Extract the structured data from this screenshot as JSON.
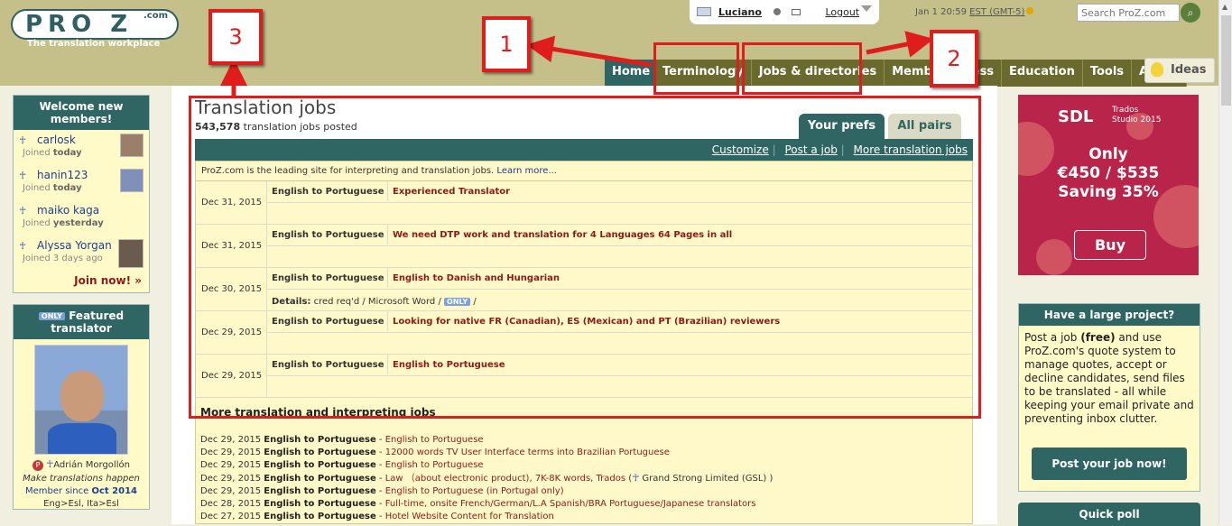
{
  "header": {
    "logo_text": "PRO Z",
    "logo_com": ".com",
    "tagline": "The translation workplace",
    "user": "Luciano",
    "logout": "Logout",
    "clock": "Jan 1 20:59",
    "timezone": "EST (GMT-5)",
    "search_placeholder": "Search ProZ.com"
  },
  "nav": [
    "Home",
    "Terminology",
    "Jobs & directories",
    "Member access",
    "Education",
    "Tools",
    "About"
  ],
  "ideas": "Ideas",
  "welcome": {
    "title": "Welcome new members!",
    "members": [
      {
        "name": "carlosk",
        "joined": "Joined",
        "when": "today"
      },
      {
        "name": "hanin123",
        "joined": "Joined",
        "when": "today"
      },
      {
        "name": "maiko kaga",
        "joined": "Joined",
        "when": "yesterday"
      },
      {
        "name": "Alyssa Yorgan",
        "joined": "Joined 3 days ago",
        "when": ""
      }
    ],
    "join_now": "Join now! »"
  },
  "featured": {
    "only_badge": "ONLY",
    "title": "Featured translator",
    "p_badge": "P",
    "name": "Adrián Morgollón",
    "tagline": "Make translations happen",
    "since_prefix": "Member since",
    "since": "Oct 2014",
    "pairs": "Eng>Esl, Ita>Esl"
  },
  "jobs": {
    "title": "Translation jobs",
    "count": "543,578",
    "count_label": "translation jobs posted",
    "tab_prefs": "Your prefs",
    "tab_all": "All pairs",
    "bar_links": [
      "Customize",
      "Post a job",
      "More translation jobs"
    ],
    "bar_sep": "|",
    "lead_text": "ProZ.com is the leading site for interpreting and translation jobs.",
    "lead_link": "Learn more...",
    "rows": [
      {
        "date": "Dec 31, 2015",
        "pair": "English to Portuguese",
        "title": "Experienced Translator",
        "details": ""
      },
      {
        "date": "Dec 31, 2015",
        "pair": "English to Portuguese",
        "title": "We need DTP work and translation for 4 Languages 64 Pages in all",
        "details": ""
      },
      {
        "date": "Dec 30, 2015",
        "pair": "English to Portuguese",
        "title": "English to Danish and Hungarian",
        "details_label": "Details:",
        "details": "cred req'd / Microsoft Word /",
        "details_badge": "ONLY",
        "details_end": "/"
      },
      {
        "date": "Dec 29, 2015",
        "pair": "English to Portuguese",
        "title": "Looking for native FR (Canadian), ES (Mexican) and PT (Brazilian) reviewers",
        "details": ""
      },
      {
        "date": "Dec 29, 2015",
        "pair": "English to Portuguese",
        "title": "English to Portuguese",
        "details": ""
      }
    ],
    "more_title": "More translation and interpreting jobs",
    "more": [
      {
        "date": "Dec 29, 2015",
        "pair": "English to Portuguese",
        "sep": " - ",
        "title": "English to Portuguese"
      },
      {
        "date": "Dec 29, 2015",
        "pair": "English to Portuguese",
        "sep": " - ",
        "title": "12000 words TV User Interface terms into Brazilian Portuguese"
      },
      {
        "date": "Dec 29, 2015",
        "pair": "English to Portuguese",
        "sep": " - ",
        "title": "English to Portuguese"
      },
      {
        "date": "Dec 29, 2015",
        "pair": "English to Portuguese",
        "sep": " - ",
        "title": "Law （about electronic product), 7K-8K words, Trados (",
        "suffix": " Grand Strong Limited (GSL) )"
      },
      {
        "date": "Dec 29, 2015",
        "pair": "English to Portuguese",
        "sep": " - ",
        "title": "English to Portuguese (in Portugal only)"
      },
      {
        "date": "Dec 28, 2015",
        "pair": "English to Portuguese",
        "sep": " - ",
        "title": "Full-time, onsite French/German/L.A Spanish/BRA Portuguese/Japanese translators"
      },
      {
        "date": "Dec 27, 2015",
        "pair": "English to Portuguese",
        "sep": " - ",
        "title": "Hotel Website Content for Translation"
      }
    ]
  },
  "ad": {
    "brand": "SDL",
    "product": "Trados\nStudio 2015",
    "line1": "Only",
    "line2": "€450 / $535",
    "line3": "Saving 35%",
    "buy": "Buy"
  },
  "project": {
    "title": "Have a large project?",
    "text_a": "Post a job ",
    "text_free": "(free)",
    "text_b": " and use ProZ.com's quote system to manage quotes, accept or decline candidates, send files to be translated - all while keeping your email private and preventing inbox clutter.",
    "button": "Post your job now!"
  },
  "poll": {
    "title": "Quick poll"
  },
  "annotations": [
    "1",
    "2",
    "3"
  ],
  "colors": {
    "accent": "#2f6663",
    "annotation": "#e01d1d",
    "joblink": "#8b1a1a"
  }
}
